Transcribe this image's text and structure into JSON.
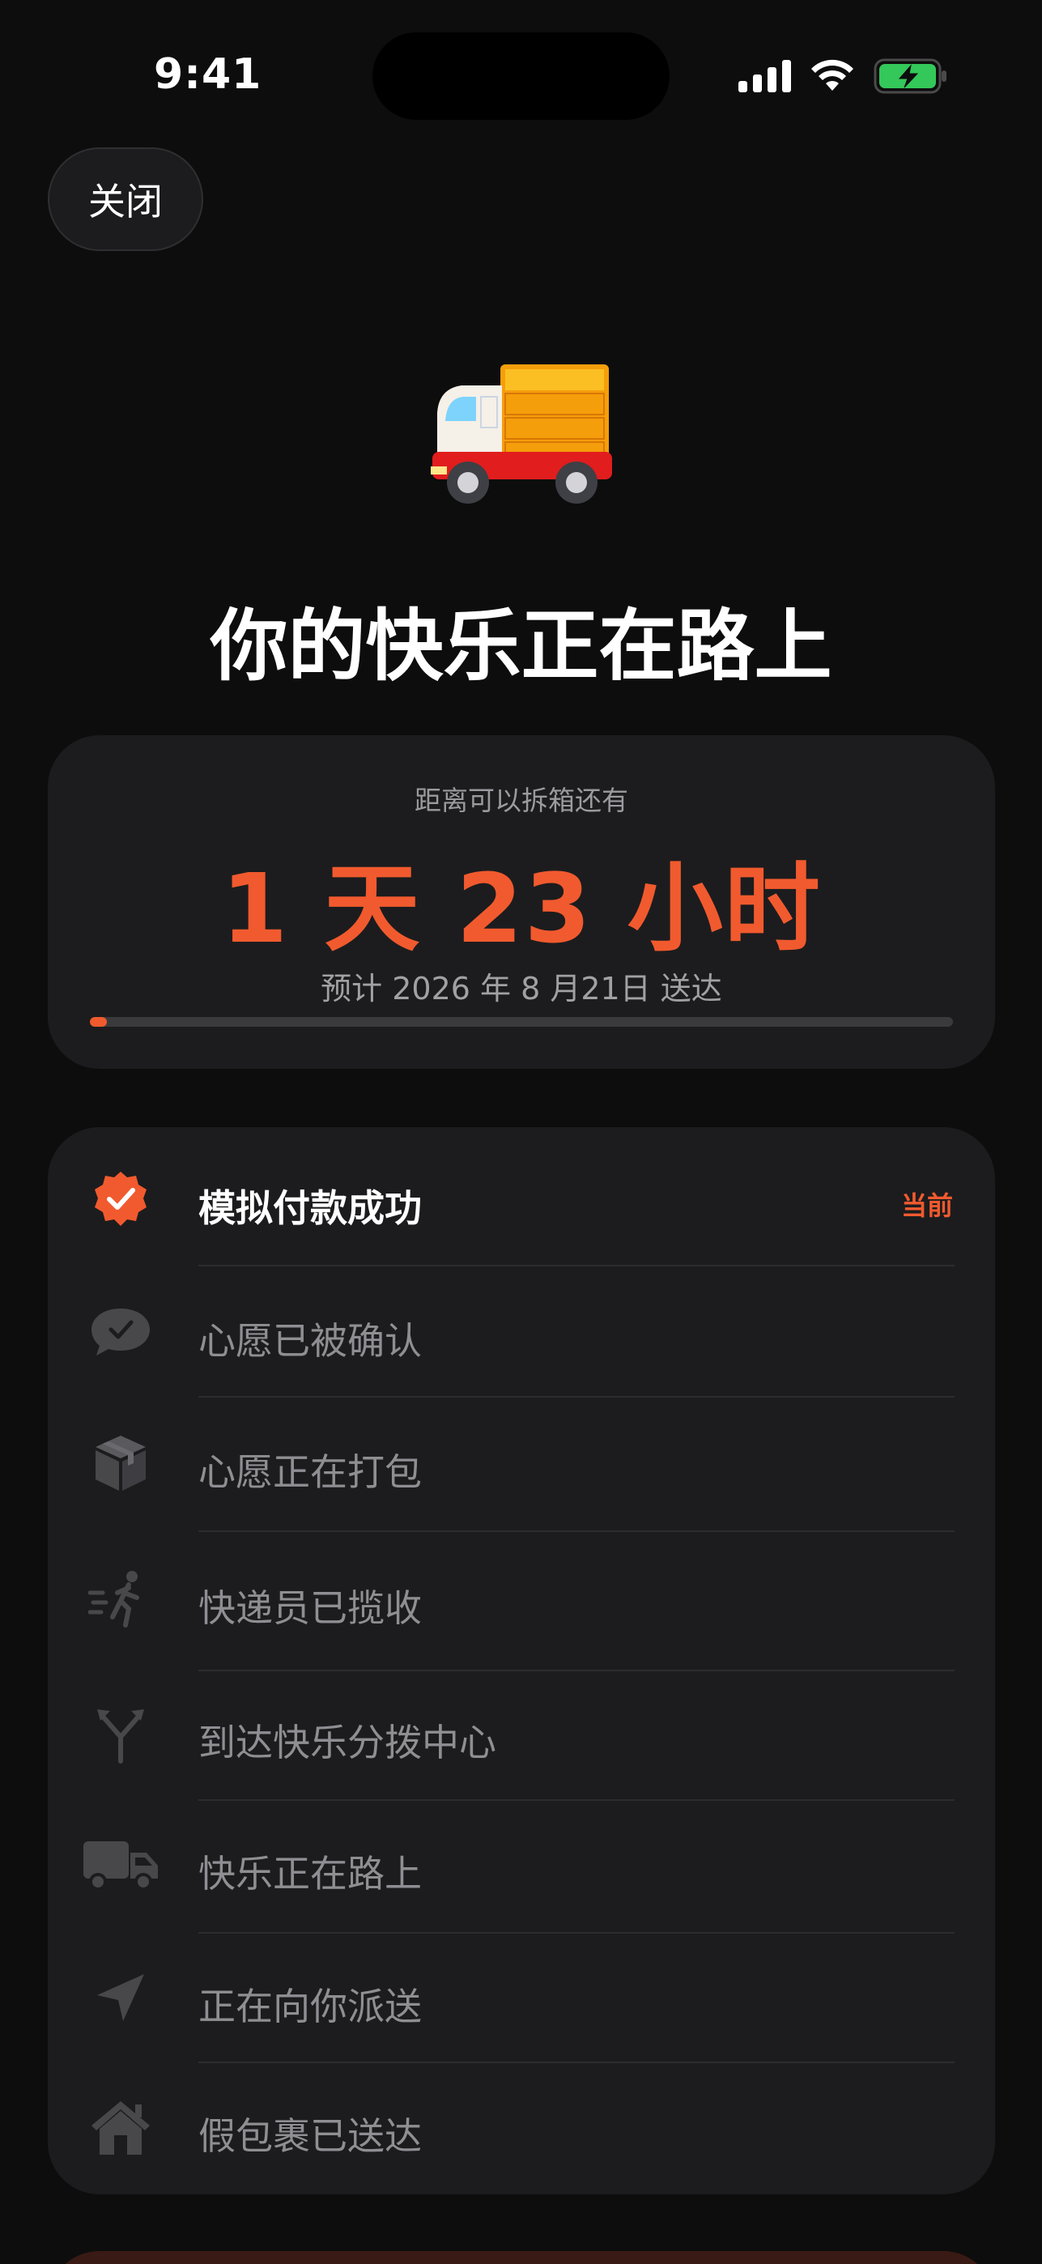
{
  "status_bar": {
    "time": "9:41"
  },
  "header": {
    "close_label": "关闭"
  },
  "hero": {
    "headline": "你的快乐正在路上"
  },
  "countdown": {
    "label": "距离可以拆箱还有",
    "value": "1 天 23 小时",
    "eta": "预计 2026 年 8 月21日 送达",
    "progress": 0.02
  },
  "steps": [
    {
      "label": "模拟付款成功",
      "icon": "checkmark-seal-icon",
      "active": true,
      "tag": "当前"
    },
    {
      "label": "心愿已被确认",
      "icon": "message-check-icon"
    },
    {
      "label": "心愿正在打包",
      "icon": "package-icon"
    },
    {
      "label": "快递员已揽收",
      "icon": "running-person-icon"
    },
    {
      "label": "到达快乐分拨中心",
      "icon": "fork-arrow-icon"
    },
    {
      "label": "快乐正在路上",
      "icon": "truck-icon"
    },
    {
      "label": "正在向你派送",
      "icon": "location-arrow-icon"
    },
    {
      "label": "假包裹已送达",
      "icon": "house-icon"
    }
  ],
  "colors": {
    "accent": "#f15a2e",
    "card": "#1c1c1e",
    "background": "#0d0d0d",
    "battery": "#34c759"
  }
}
